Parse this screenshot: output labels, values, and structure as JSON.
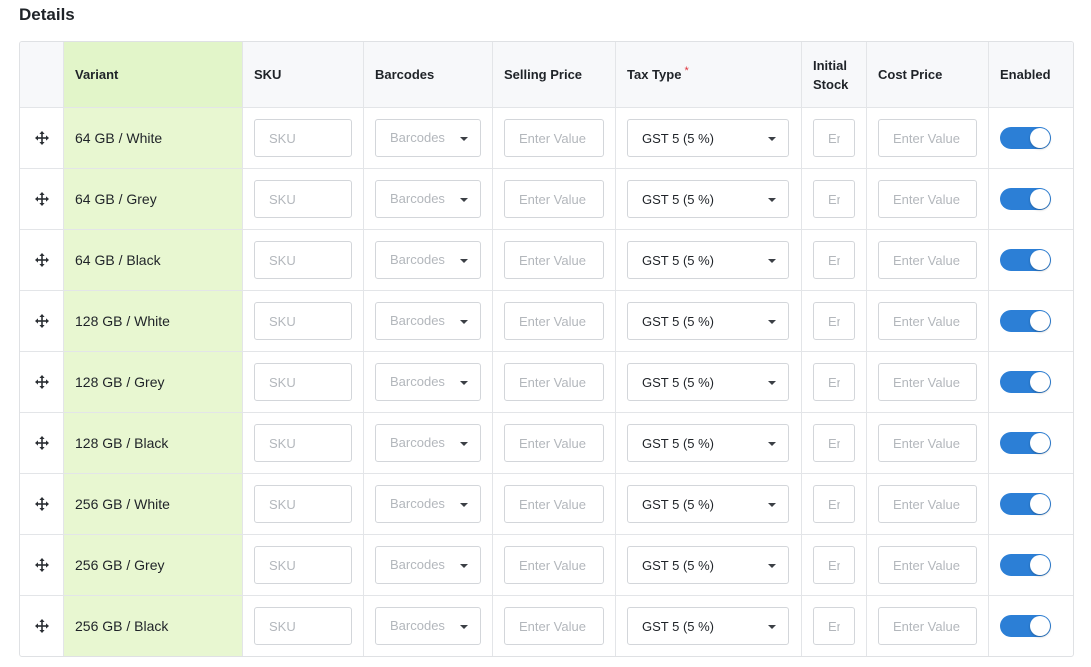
{
  "section": {
    "title": "Details"
  },
  "headers": {
    "variant": "Variant",
    "sku": "SKU",
    "barcodes": "Barcodes",
    "selling_price": "Selling Price",
    "tax_type": "Tax Type",
    "tax_required_mark": "*",
    "initial_stock_line1": "Initial",
    "initial_stock_line2": "Stock",
    "cost_price": "Cost Price",
    "enabled": "Enabled"
  },
  "placeholders": {
    "sku": "SKU",
    "barcodes": "Barcodes",
    "selling_price": "Enter Value",
    "initial_stock": "Enter Value",
    "cost_price": "Enter Value"
  },
  "colors": {
    "variant_column_bg": "#e8f7d1",
    "toggle_on": "#2c7fd6",
    "required_mark": "#e0343d"
  },
  "icons": {
    "drag": "drag-move-icon",
    "dropdown": "chevron-down-icon"
  },
  "rows": [
    {
      "variant": "64 GB / White",
      "sku": "",
      "selling_price": "",
      "tax_type": "GST 5 (5 %)",
      "initial_stock": "",
      "cost_price": "",
      "enabled": true
    },
    {
      "variant": "64 GB / Grey",
      "sku": "",
      "selling_price": "",
      "tax_type": "GST 5 (5 %)",
      "initial_stock": "",
      "cost_price": "",
      "enabled": true
    },
    {
      "variant": "64 GB / Black",
      "sku": "",
      "selling_price": "",
      "tax_type": "GST 5 (5 %)",
      "initial_stock": "",
      "cost_price": "",
      "enabled": true
    },
    {
      "variant": "128 GB / White",
      "sku": "",
      "selling_price": "",
      "tax_type": "GST 5 (5 %)",
      "initial_stock": "",
      "cost_price": "",
      "enabled": true
    },
    {
      "variant": "128 GB / Grey",
      "sku": "",
      "selling_price": "",
      "tax_type": "GST 5 (5 %)",
      "initial_stock": "",
      "cost_price": "",
      "enabled": true
    },
    {
      "variant": "128 GB / Black",
      "sku": "",
      "selling_price": "",
      "tax_type": "GST 5 (5 %)",
      "initial_stock": "",
      "cost_price": "",
      "enabled": true
    },
    {
      "variant": "256 GB / White",
      "sku": "",
      "selling_price": "",
      "tax_type": "GST 5 (5 %)",
      "initial_stock": "",
      "cost_price": "",
      "enabled": true
    },
    {
      "variant": "256 GB / Grey",
      "sku": "",
      "selling_price": "",
      "tax_type": "GST 5 (5 %)",
      "initial_stock": "",
      "cost_price": "",
      "enabled": true
    },
    {
      "variant": "256 GB / Black",
      "sku": "",
      "selling_price": "",
      "tax_type": "GST 5 (5 %)",
      "initial_stock": "",
      "cost_price": "",
      "enabled": true
    }
  ]
}
